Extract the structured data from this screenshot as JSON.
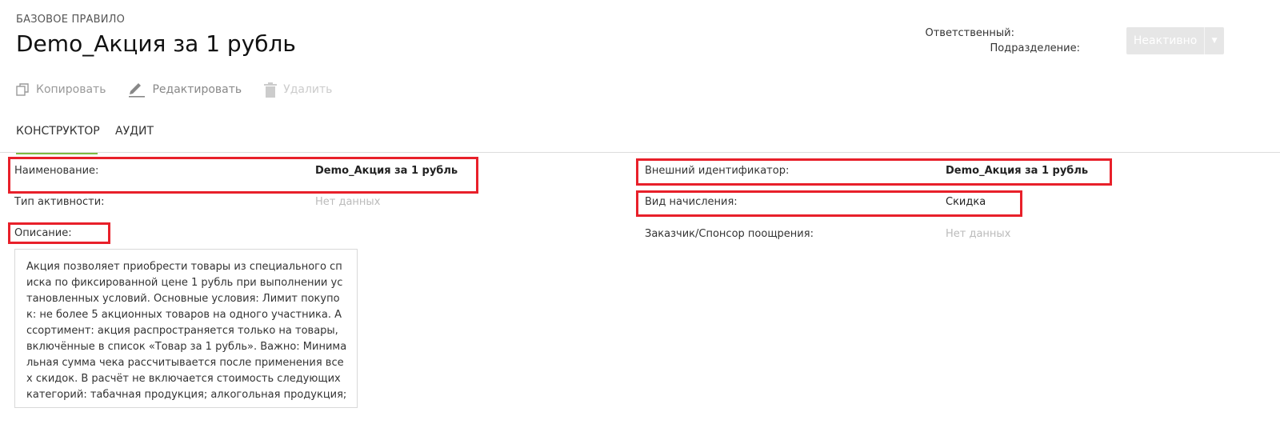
{
  "header": {
    "overline": "БАЗОВОЕ ПРАВИЛО",
    "title": "Demo_Акция за 1 рубль",
    "responsible_label": "Ответственный:",
    "department_label": "Подразделение:",
    "status_button": "Неактивно"
  },
  "toolbar": {
    "copy": "Копировать",
    "edit": "Редактировать",
    "delete": "Удалить"
  },
  "tabs": [
    {
      "label": "КОНСТРУКТОР",
      "active": true
    },
    {
      "label": "АУДИТ",
      "active": false
    }
  ],
  "fields": {
    "name": {
      "label": "Наименование:",
      "value": "Demo_Акция за 1 рубль"
    },
    "activity_type": {
      "label": "Тип активности:",
      "value": "Нет данных"
    },
    "description": {
      "label": "Описание:",
      "value": "Акция позволяет приобрести товары из специального списка по фиксированной цене 1 рубль при выполнении установленных условий. Основные условия: Лимит покупок: не более 5 акционных товаров на одного участника. Ассортимент: акция распространяется только на товары, включённые в список «Товар за 1 рубль». Важно: Минимальная сумма чека рассчитывается после применения всех скидок. В расчёт не включается стоимость следующих категорий: табачная продукция; алкогольная продукция;"
    },
    "external_id": {
      "label": "Внешний идентификатор:",
      "value": "Demo_Акция за 1 рубль"
    },
    "accrual_type": {
      "label": "Вид начисления:",
      "value": "Скидка"
    },
    "sponsor": {
      "label": "Заказчик/Спонсор поощрения:",
      "value": "Нет данных"
    }
  },
  "colors": {
    "accent_green": "#7dbb42",
    "highlight_red": "#e8202a",
    "status_button_bg": "#e6e6e6"
  }
}
